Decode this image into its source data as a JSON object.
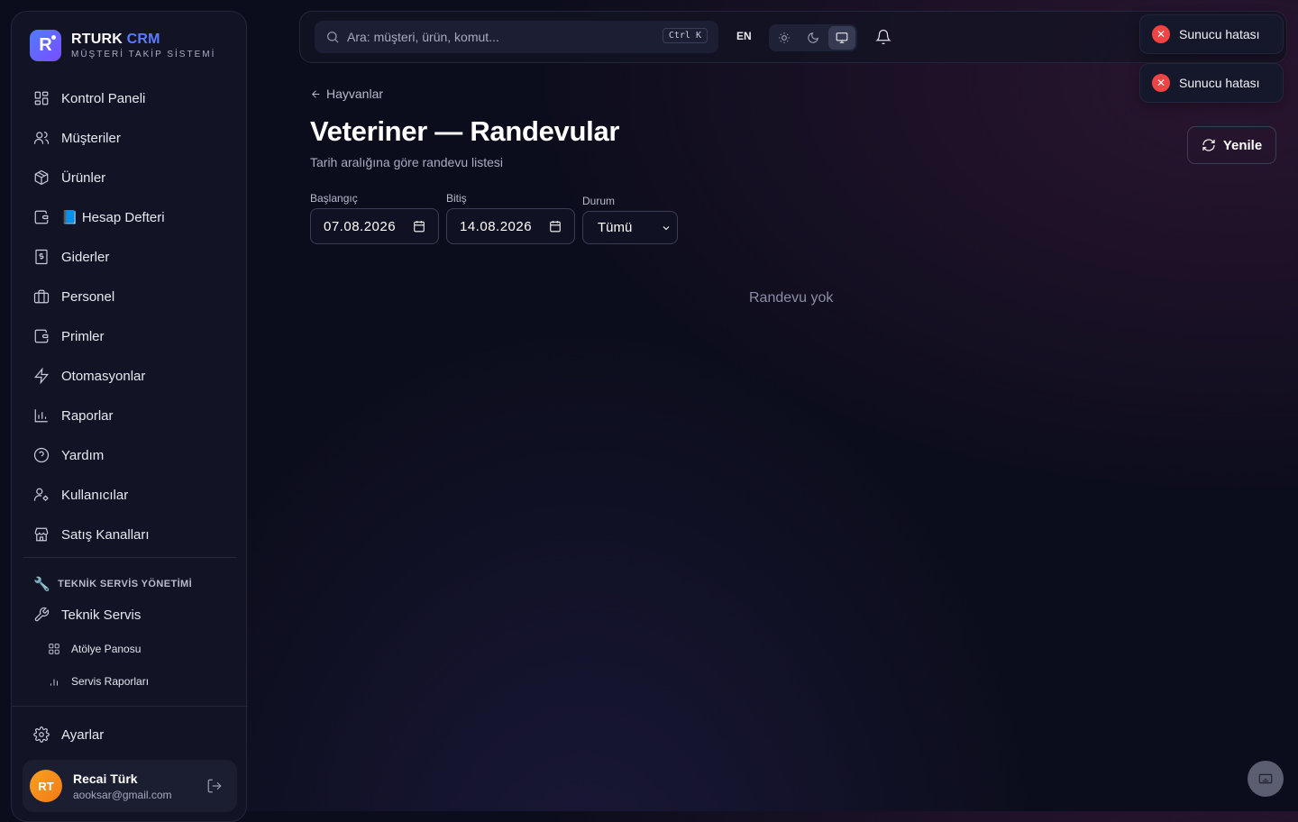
{
  "brand": {
    "name_main": "RTURK",
    "name_accent": "CRM",
    "subtitle": "MÜŞTERİ TAKİP SİSTEMİ",
    "logo_letter": "R"
  },
  "nav": [
    {
      "label": "Kontrol Paneli",
      "icon": "dashboard-icon"
    },
    {
      "label": "Müşteriler",
      "icon": "users-icon"
    },
    {
      "label": "Ürünler",
      "icon": "package-icon"
    },
    {
      "label": "📘 Hesap Defteri",
      "icon": "wallet-icon"
    },
    {
      "label": "Giderler",
      "icon": "receipt-icon"
    },
    {
      "label": "Personel",
      "icon": "briefcase-icon"
    },
    {
      "label": "Primler",
      "icon": "wallet-icon"
    },
    {
      "label": "Otomasyonlar",
      "icon": "zap-icon"
    },
    {
      "label": "Raporlar",
      "icon": "bar-chart-icon"
    },
    {
      "label": "Yardım",
      "icon": "help-icon"
    },
    {
      "label": "Kullanıcılar",
      "icon": "user-cog-icon"
    },
    {
      "label": "Satış Kanalları",
      "icon": "store-icon"
    }
  ],
  "service_section": {
    "title": "TEKNİK SERVİS YÖNETİMİ",
    "main_label": "Teknik Servis",
    "sub_items": [
      {
        "label": "Atölye Panosu",
        "icon": "grid-icon"
      },
      {
        "label": "Servis Raporları",
        "icon": "bar-chart-icon"
      }
    ]
  },
  "settings_label": "Ayarlar",
  "user": {
    "initials": "RT",
    "name": "Recai Türk",
    "email": "aooksar@gmail.com"
  },
  "topbar": {
    "search_placeholder": "Ara: müşteri, ürün, komut...",
    "shortcut": "Ctrl K",
    "language": "EN",
    "theme_selected": "system"
  },
  "toasts": [
    {
      "message": "Sunucu hatası",
      "type": "error"
    },
    {
      "message": "Sunucu hatası",
      "type": "error"
    }
  ],
  "page": {
    "back_label": "Hayvanlar",
    "title": "Veteriner — Randevular",
    "subtitle": "Tarih aralığına göre randevu listesi",
    "refresh_label": "Yenile",
    "start_label": "Başlangıç",
    "start_value": "07.08.2026",
    "end_label": "Bitiş",
    "end_value": "14.08.2026",
    "status_label": "Durum",
    "status_value": "Tümü",
    "empty_text": "Randevu yok"
  },
  "colors": {
    "accent": "#5b7cff",
    "error": "#ef4444",
    "avatar": "#f7a021",
    "background": "#0c0d1c"
  }
}
